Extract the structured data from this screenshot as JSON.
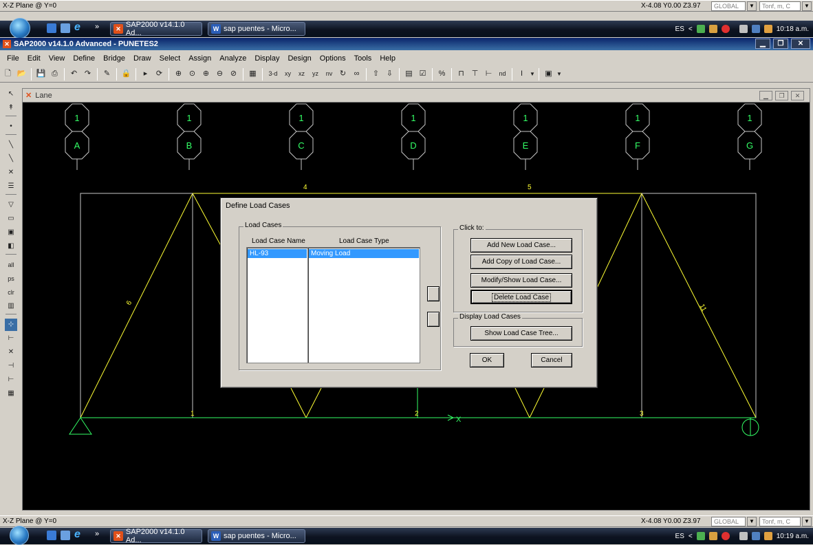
{
  "status_top": {
    "plane": "X-Z Plane @ Y=0",
    "coords": "X-4.08  Y0.00  Z3.97",
    "coord_sys": "GLOBAL",
    "units": "Tonf, m, C"
  },
  "status_bottom": {
    "plane": "X-Z Plane @ Y=0",
    "coords": "X-4.08  Y0.00  Z3.97",
    "coord_sys": "GLOBAL",
    "units": "Tonf, m, C"
  },
  "taskbar_top": {
    "chevron": "»",
    "task1": "SAP2000 v14.1.0 Ad...",
    "task2": "sap puentes - Micro...",
    "lang": "ES",
    "arrow": "<",
    "clock": "10:18 a.m."
  },
  "taskbar_bottom": {
    "chevron": "»",
    "task1": "SAP2000 v14.1.0 Ad...",
    "task2": "sap puentes - Micro...",
    "lang": "ES",
    "arrow": "<",
    "clock": "10:19 a.m."
  },
  "app": {
    "title": "SAP2000 v14.1.0 Advanced  - PUNETES2"
  },
  "menu": [
    "File",
    "Edit",
    "View",
    "Define",
    "Bridge",
    "Draw",
    "Select",
    "Assign",
    "Analyze",
    "Display",
    "Design",
    "Options",
    "Tools",
    "Help"
  ],
  "toolbar_text": {
    "view3d": "3-d",
    "xy": "xy",
    "xz": "xz",
    "yz": "yz",
    "nv": "nv",
    "nd": "nd",
    "pct": "%"
  },
  "left_tool_text": {
    "all": "all",
    "ps": "ps",
    "clr": "clr"
  },
  "child": {
    "title": "Lane"
  },
  "grid_bubbles": {
    "top": [
      "1",
      "1",
      "1",
      "1",
      "1",
      "1",
      "1"
    ],
    "bottom": [
      "A",
      "B",
      "C",
      "D",
      "E",
      "F",
      "G"
    ]
  },
  "frame_labels": {
    "l4": "4",
    "l5": "5",
    "l6": "6",
    "l11": "11",
    "l1": "1",
    "l2": "2",
    "l3": "3",
    "x": "X"
  },
  "dialog": {
    "title": "Define Load Cases",
    "load_cases_group": "Load Cases",
    "col_name": "Load Case Name",
    "col_type": "Load Case Type",
    "rows": [
      {
        "name": "HL-93",
        "type": "Moving Load"
      }
    ],
    "click_to_group": "Click to:",
    "add_new": "Add New Load Case...",
    "add_copy": "Add Copy of Load Case...",
    "modify_show": "Modify/Show Load Case...",
    "delete": "Delete Load Case",
    "display_group": "Display Load Cases",
    "show_tree": "Show Load Case Tree...",
    "ok": "OK",
    "cancel": "Cancel"
  },
  "colors": {
    "frame_yellow": "#ffff33",
    "grid_white": "#c8c8c8",
    "green": "#33ff66",
    "selection": "#3399ff",
    "title_blue": "#0a246a"
  }
}
